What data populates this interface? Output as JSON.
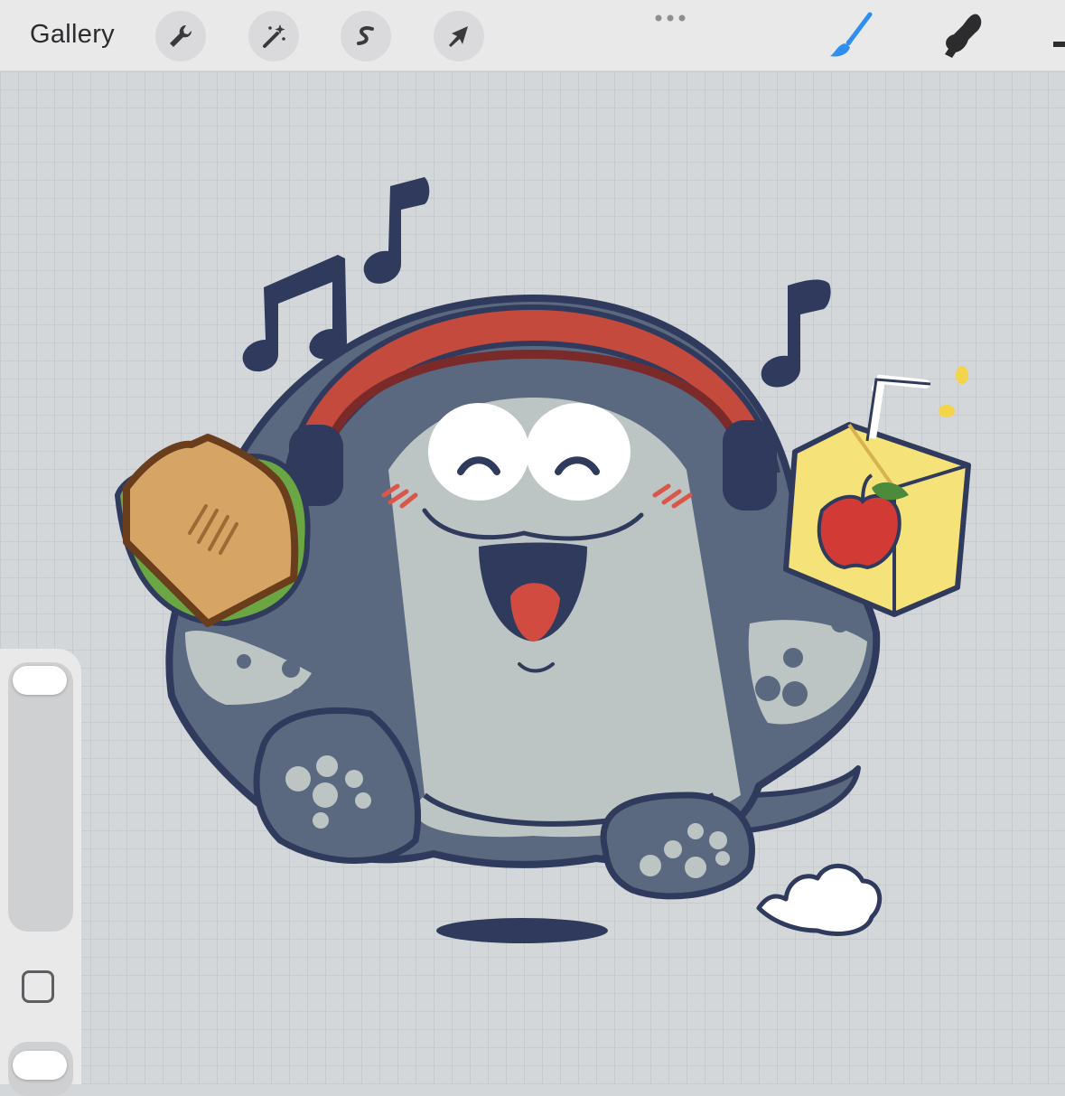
{
  "toolbar": {
    "gallery_label": "Gallery",
    "left_tools": [
      "wrench-icon",
      "magic-wand-icon",
      "selection-s-icon",
      "transform-arrow-icon"
    ],
    "right_tools": [
      "brush-icon",
      "smudge-icon",
      "eraser-icon"
    ],
    "active_tool": "brush",
    "active_color": "#2f8ff0"
  },
  "canvas": {
    "background_color": "#d3d7da",
    "grid": true
  },
  "sidebar": {
    "brush_size_slider": "top",
    "opacity_slider": "bottom",
    "modifier_button": "square-modifier-icon"
  }
}
